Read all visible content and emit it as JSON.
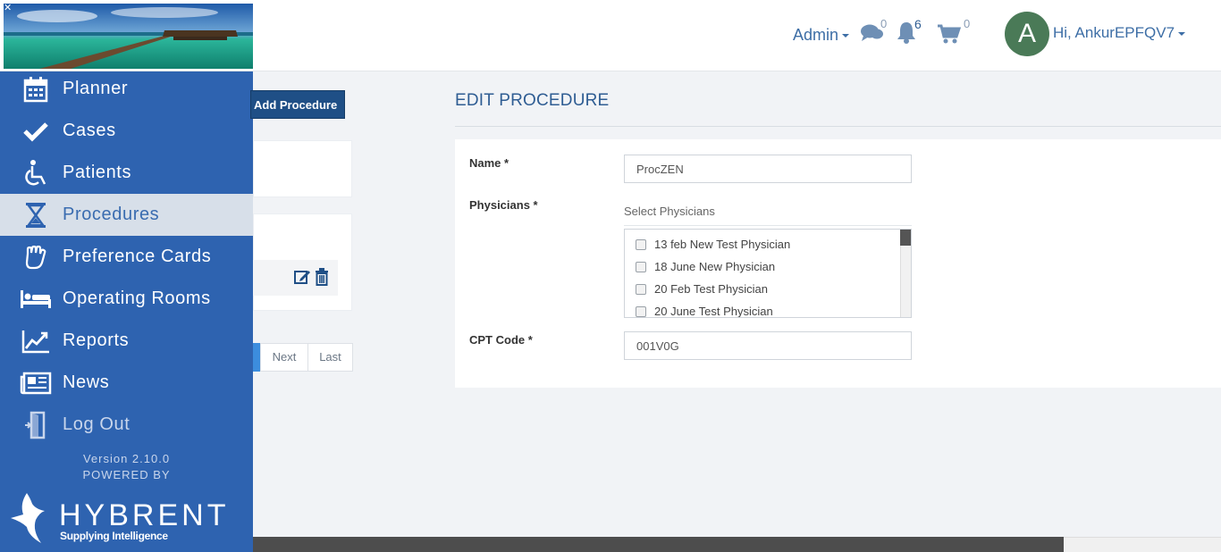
{
  "header": {
    "admin_label": "Admin",
    "messages_count": "0",
    "notifications_count": "6",
    "cart_count": "0",
    "avatar_letter": "A",
    "user_greeting": "Hi, AnkurEPFQV7"
  },
  "sidebar": {
    "items": [
      {
        "label": "Planner",
        "icon": "calendar-icon"
      },
      {
        "label": "Cases",
        "icon": "checkmark-icon"
      },
      {
        "label": "Patients",
        "icon": "wheelchair-icon"
      },
      {
        "label": "Procedures",
        "icon": "hourglass-icon"
      },
      {
        "label": "Preference Cards",
        "icon": "glove-icon"
      },
      {
        "label": "Operating Rooms",
        "icon": "bed-icon"
      },
      {
        "label": "Reports",
        "icon": "chart-line-icon"
      },
      {
        "label": "News",
        "icon": "newspaper-icon"
      },
      {
        "label": "Log Out",
        "icon": "door-exit-icon"
      }
    ],
    "active_item": "Procedures",
    "version": "Version 2.10.0",
    "powered_by": "POWERED BY",
    "brand_name": "HYBRENT",
    "brand_tagline": "Supplying Intelligence"
  },
  "list_panel": {
    "add_button_label": "Add Procedure",
    "pagination": {
      "next_label": "Next",
      "last_label": "Last"
    }
  },
  "edit_form": {
    "title": "EDIT PROCEDURE",
    "name_label": "Name *",
    "name_value": "ProcZEN",
    "physicians_label": "Physicians *",
    "physicians_select_title": "Select Physicians",
    "physicians_options": [
      {
        "label": "13 feb New Test Physician",
        "checked": false
      },
      {
        "label": "18 June New Physician",
        "checked": false
      },
      {
        "label": "20 Feb Test Physician",
        "checked": false
      },
      {
        "label": "20 June Test Physician",
        "checked": false
      }
    ],
    "cpt_label": "CPT Code *",
    "cpt_value": "001V0G"
  },
  "colors": {
    "sidebar": "#2e63b0",
    "active_item_bg": "#d7dfe9",
    "accent_text": "#3d6ea6",
    "button_dark": "#1f4f86"
  }
}
